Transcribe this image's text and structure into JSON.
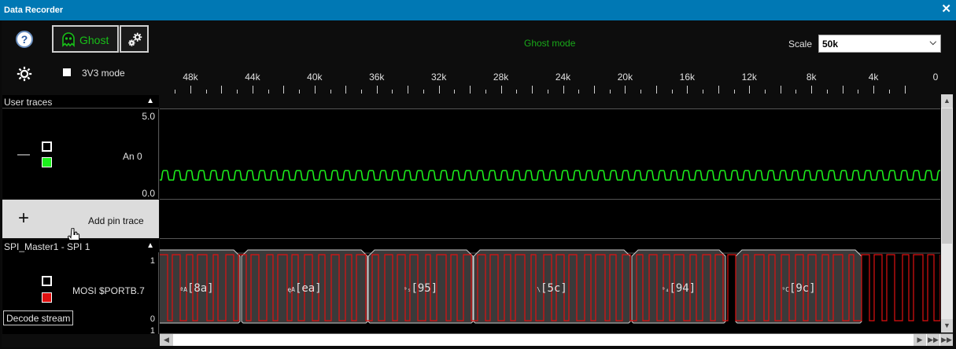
{
  "window": {
    "title": "Data Recorder",
    "close_glyph": "✕"
  },
  "toolbar": {
    "help_label": "?",
    "ghost_label": "Ghost",
    "mode_text": "Ghost mode",
    "scale_label": "Scale",
    "scale_value": "50k",
    "mode_3v3_label": "3V3 mode",
    "mode_3v3_checked": true
  },
  "ruler": {
    "labels": [
      "48k",
      "44k",
      "40k",
      "36k",
      "32k",
      "28k",
      "24k",
      "20k",
      "16k",
      "12k",
      "8k",
      "4k",
      "0"
    ]
  },
  "user_traces": {
    "header": "User traces",
    "analog": {
      "max_label": "5.0",
      "min_label": "0.0",
      "channel_label": "An 0",
      "remove_glyph": "—",
      "color": "#1cf01c"
    },
    "add_pin_glyph": "+",
    "add_pin_label": "Add pin trace"
  },
  "spi": {
    "header": "SPI_Master1 - SPI 1",
    "top_label": "1",
    "bottom_label": "0",
    "extra_label": "1",
    "channel_label": "MOSI $PORTB.7",
    "color": "#e01010",
    "decode_tooltip": "Decode stream",
    "frames": [
      {
        "prefix": "ªA",
        "hex": "[8a]"
      },
      {
        "prefix": "ęA",
        "hex": "[ea]"
      },
      {
        "prefix": "⁹₅",
        "hex": "[95]"
      },
      {
        "prefix": "\\",
        "hex": "[5c]"
      },
      {
        "prefix": "⁹₄",
        "hex": "[94]"
      },
      {
        "prefix": "⁹C",
        "hex": "[9c]"
      }
    ]
  },
  "icons": {
    "help": "help-icon",
    "ghost": "ghost-icon",
    "settings": "settings-gear-icon",
    "collapse": "collapse-up-icon",
    "scroll_up": "scroll-up-icon",
    "scroll_down": "scroll-down-icon",
    "scroll_left": "scroll-left-icon",
    "scroll_right": "scroll-right-icon"
  }
}
